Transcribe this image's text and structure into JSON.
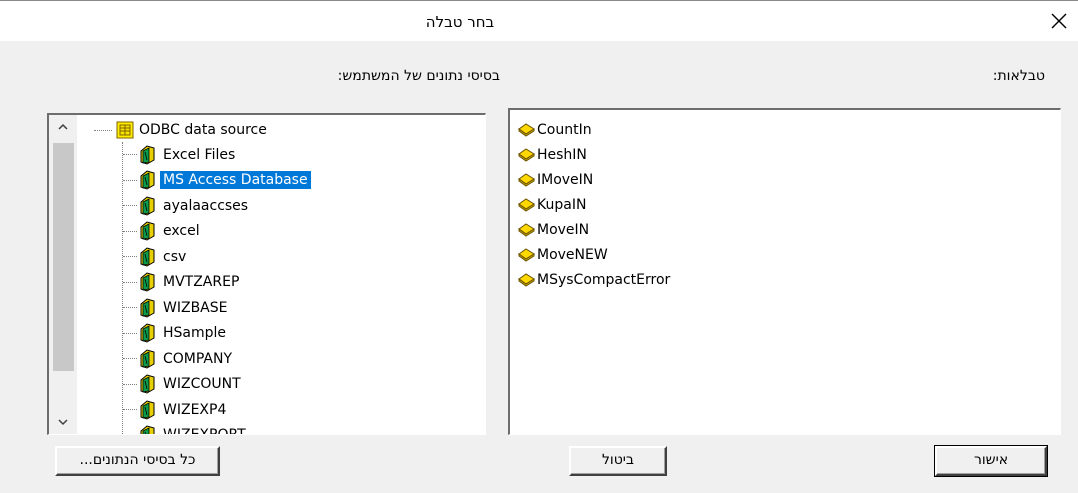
{
  "dialog": {
    "title": "בחר טבלה",
    "databases_label": "בסיסי נתונים של המשתמש:",
    "tables_label": "טבלאות:"
  },
  "tree": {
    "root": "ODBC data source",
    "nodes": [
      {
        "label": "Excel Files"
      },
      {
        "label": "MS Access Database",
        "selected": true
      },
      {
        "label": "ayalaaccses"
      },
      {
        "label": "excel"
      },
      {
        "label": "csv"
      },
      {
        "label": "MVTZAREP"
      },
      {
        "label": "WIZBASE"
      },
      {
        "label": "HSample"
      },
      {
        "label": "COMPANY"
      },
      {
        "label": "WIZCOUNT"
      },
      {
        "label": "WIZEXP4"
      },
      {
        "label": "WIZEXPORT"
      }
    ]
  },
  "tables": [
    "CountIn",
    "HeshIN",
    "IMoveIN",
    "KupaIN",
    "MoveIN",
    "MoveNEW",
    "MSysCompactError"
  ],
  "buttons": {
    "all_databases": "כל בסיסי הנתונים...",
    "cancel": "ביטול",
    "ok": "אישור"
  },
  "colors": {
    "selection": "#0078d7",
    "dialog_bg": "#f0f0f0",
    "table_icon": "#ffd800",
    "db_icon_green": "#0a9a4a",
    "db_icon_yellow": "#e8d000"
  },
  "icons": {
    "close": "close-icon",
    "scroll_up": "chevron-up-icon",
    "scroll_down": "chevron-down-icon",
    "root": "odbc-source-icon",
    "database": "database-icon",
    "table": "table-icon"
  }
}
